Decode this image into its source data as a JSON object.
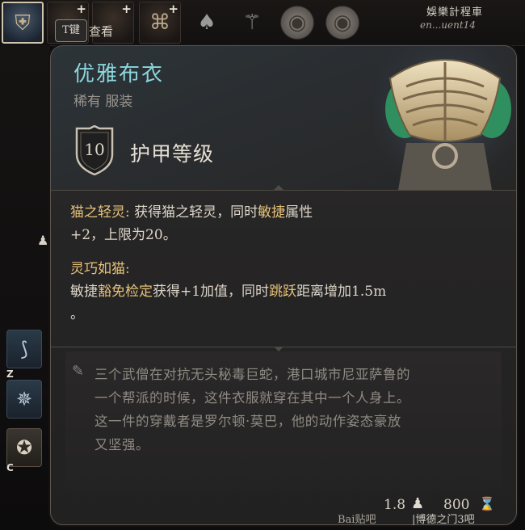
{
  "topbar": {
    "slots": [
      {
        "icon": "armor-portrait-icon",
        "selected": true
      },
      {
        "icon": "cloak-slot-icon",
        "has_plus": true
      },
      {
        "icon": "boots-slot-icon",
        "has_plus": true
      },
      {
        "icon": "ring-slot-icon",
        "has_plus": true
      },
      {
        "icon": "mace-icon"
      },
      {
        "icon": "staff-icon"
      },
      {
        "icon": "shield-icon"
      },
      {
        "icon": "shield-icon"
      }
    ],
    "examine_key": "T键",
    "examine_label": "查看"
  },
  "watermarks": {
    "top_right": "娛樂計程車",
    "top_right_handle": "en...uent14",
    "bottom_left": "Bai贴吧",
    "bottom_right": "|博德之门3吧"
  },
  "left_panel": {
    "skills": [
      {
        "key": "Z",
        "icon": "leap-skill-icon"
      },
      {
        "key": "",
        "icon": "dance-skill-icon"
      },
      {
        "key": "C",
        "icon": "crouch-skill-icon"
      }
    ]
  },
  "item": {
    "name": "优雅布衣",
    "rarity": "稀有",
    "type": "服装",
    "armor_class_value": "10",
    "armor_class_label": "护甲等级",
    "properties": [
      {
        "name": "猫之轻灵:",
        "text_parts": [
          "获得猫之轻灵，同时",
          "敏捷",
          "属性"
        ],
        "line2": "+2，上限为20。"
      },
      {
        "name": "灵巧如猫:",
        "line1_parts": [
          "敏捷",
          "豁免检定",
          "获得+1加值，同时",
          "跳跃",
          "距离增加1.5m"
        ],
        "line2": "。"
      }
    ],
    "lore": [
      "三个武僧在对抗无头秘毒巨蛇，港口城市尼亚萨鲁的",
      "一个帮派的时候，这件衣服就穿在其中一个人身上。",
      "这一件的穿戴者是罗尔顿·莫巴，他的动作姿态豪放",
      "又坚强。"
    ],
    "weight": "1.8",
    "price": "800"
  },
  "colors": {
    "item_name": "#8ad6dd",
    "property_name": "#e6c27a",
    "lore_text": "#8f8a83"
  }
}
